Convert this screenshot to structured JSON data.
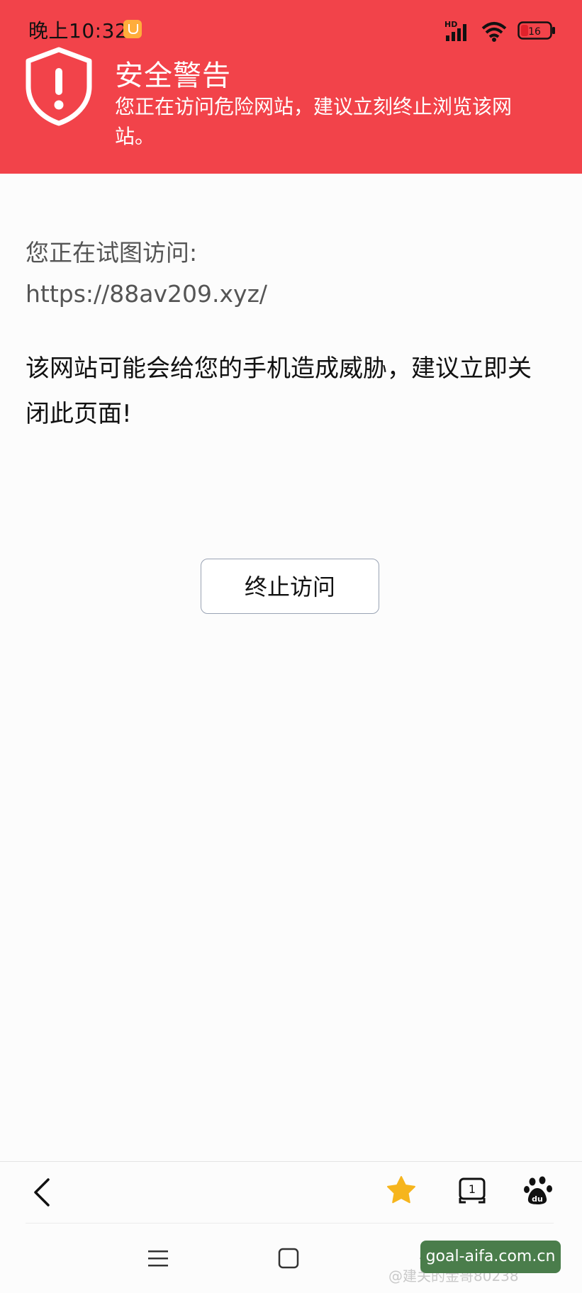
{
  "status_bar": {
    "time": "晚上10:32",
    "network_label": "HD",
    "battery_level": "16"
  },
  "header": {
    "title": "安全警告",
    "description": "您正在访问危险网站，建议立刻终止浏览该网站。"
  },
  "content": {
    "label": "您正在试图访问:",
    "url": "https://88av209.xyz/",
    "warning": "该网站可能会给您的手机造成威胁，建议立即关闭此页面!"
  },
  "actions": {
    "stop_label": "终止访问"
  },
  "toolbar": {
    "tab_count": "1"
  },
  "watermark": {
    "pill_text": "goal-aifa.com.cn",
    "under_text": "@建关的金哥80238"
  },
  "colors": {
    "header_bg": "#f2434a",
    "star": "#f6b51d",
    "button_border": "#9aa3b4"
  }
}
